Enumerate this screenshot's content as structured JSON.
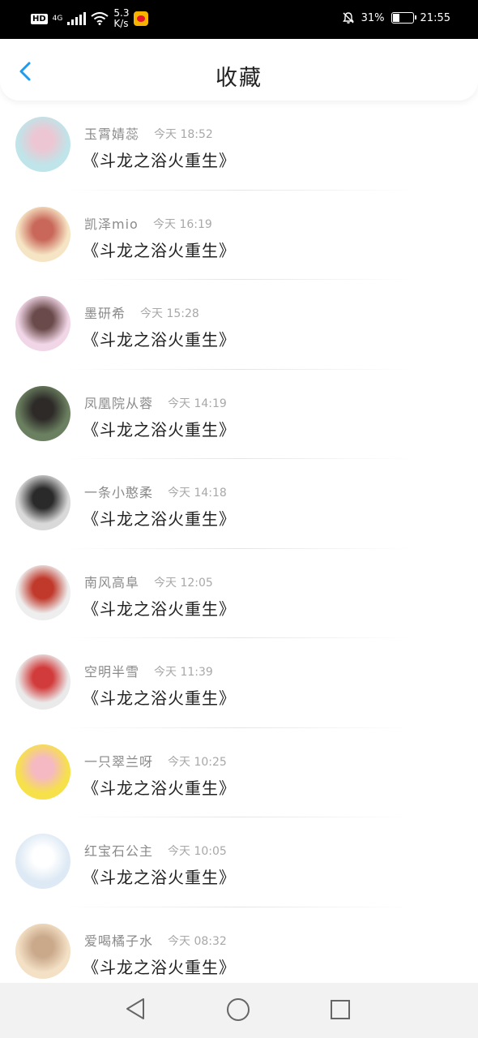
{
  "status_bar": {
    "hd": "HD",
    "network": "4G",
    "speed_value": "5.3",
    "speed_unit": "K/s",
    "battery_percent": "31%",
    "battery_level": 0.31,
    "time": "21:55"
  },
  "header": {
    "title": "收藏",
    "back_icon": "chevron-left-icon"
  },
  "favorites": [
    {
      "name": "玉霄婧蕊",
      "time": "今天 18:52",
      "book": "《斗龙之浴火重生》",
      "avatar_colors": [
        "#bfe4e9",
        "#ecc7d3"
      ]
    },
    {
      "name": "凯泽mio",
      "time": "今天 16:19",
      "book": "《斗龙之浴火重生》",
      "avatar_colors": [
        "#f6e5c4",
        "#c9685a"
      ]
    },
    {
      "name": "墨研希",
      "time": "今天 15:28",
      "book": "《斗龙之浴火重生》",
      "avatar_colors": [
        "#f1d6e7",
        "#6a4a4a"
      ]
    },
    {
      "name": "凤凰院从蓉",
      "time": "今天 14:19",
      "book": "《斗龙之浴火重生》",
      "avatar_colors": [
        "#6b8060",
        "#2d2a28"
      ]
    },
    {
      "name": "一条小憨柔",
      "time": "今天 14:18",
      "book": "《斗龙之浴火重生》",
      "avatar_colors": [
        "#d9d9d9",
        "#2a2a2a"
      ]
    },
    {
      "name": "南风高阜",
      "time": "今天 12:05",
      "book": "《斗龙之浴火重生》",
      "avatar_colors": [
        "#eeeeee",
        "#c0392b"
      ]
    },
    {
      "name": "空明半雪",
      "time": "今天 11:39",
      "book": "《斗龙之浴火重生》",
      "avatar_colors": [
        "#ebeaea",
        "#d23b3b"
      ]
    },
    {
      "name": "一只翠兰呀",
      "time": "今天 10:25",
      "book": "《斗龙之浴火重生》",
      "avatar_colors": [
        "#f6e14a",
        "#f5b9c3"
      ]
    },
    {
      "name": "红宝石公主",
      "time": "今天 10:05",
      "book": "《斗龙之浴火重生》",
      "avatar_colors": [
        "#dde9f4",
        "#ffffff"
      ]
    },
    {
      "name": "爱喝橘子水",
      "time": "今天 08:32",
      "book": "《斗龙之浴火重生》",
      "avatar_colors": [
        "#f3e0c5",
        "#caa88a"
      ]
    }
  ],
  "nav_bar": {
    "back_icon": "triangle-back-icon",
    "home_icon": "circle-home-icon",
    "recent_icon": "square-recents-icon"
  },
  "colors": {
    "accent": "#1d9bf0",
    "name_text": "#8a8a8a",
    "time_text": "#a8a8a8",
    "book_text": "#222222"
  }
}
